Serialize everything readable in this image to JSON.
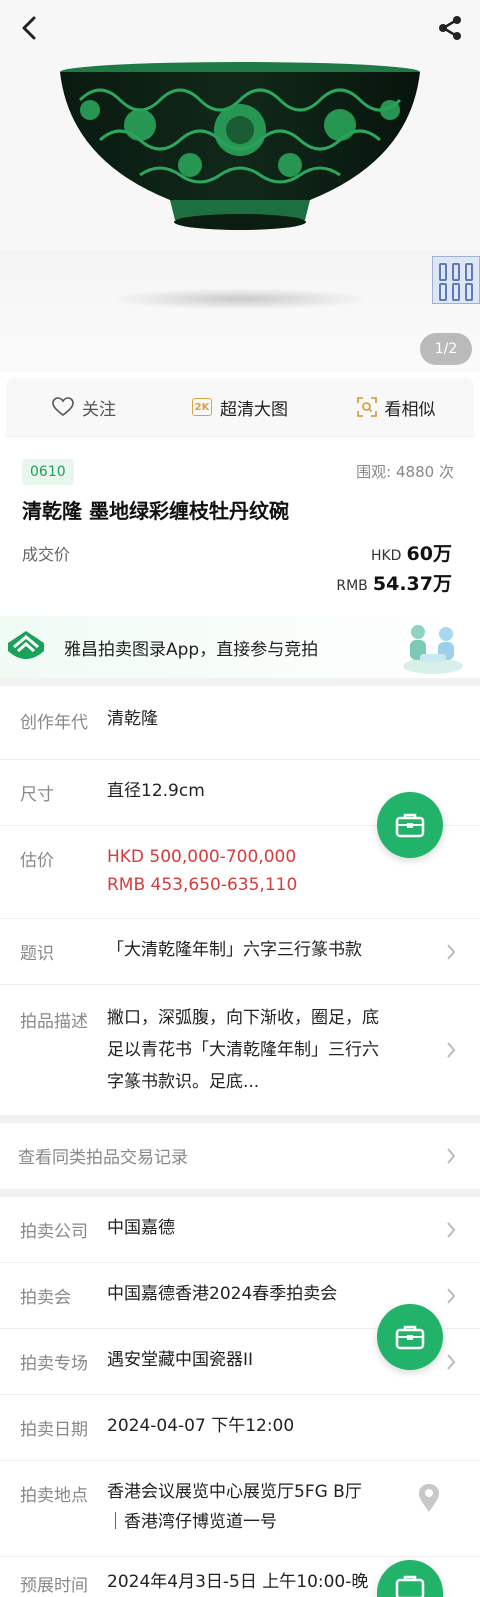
{
  "gallery": {
    "page_indicator": "1/2"
  },
  "actions": {
    "follow": "关注",
    "hd_badge": "2K",
    "hd_image": "超清大图",
    "similar": "看相似"
  },
  "lot": {
    "number": "0610",
    "views_label": "围观:",
    "views_count": "4880",
    "views_unit": "次",
    "title": "清乾隆 墨地绿彩缠枝牡丹纹碗",
    "price_label": "成交价",
    "hkd_currency": "HKD",
    "hkd_amount": "60万",
    "rmb_currency": "RMB",
    "rmb_amount": "54.37万"
  },
  "banner": {
    "text": "雅昌拍卖图录App，直接参与竞拍"
  },
  "details": {
    "era_label": "创作年代",
    "era_value": "清乾隆",
    "size_label": "尺寸",
    "size_value": "直径12.9cm",
    "estimate_label": "估价",
    "estimate_hkd": "HKD  500,000-700,000",
    "estimate_rmb": "RMB 453,650-635,110",
    "inscription_label": "题识",
    "inscription_value": "「大清乾隆年制」六字三行篆书款",
    "desc_label": "拍品描述",
    "desc_line1": "撇口，深弧腹，向下渐收，圈足，底",
    "desc_line2": "足以青花书「大清乾隆年制」三行六",
    "desc_line3": "字篆书款识。足底..."
  },
  "records_link": "查看同类拍品交易记录",
  "auction": {
    "company_label": "拍卖公司",
    "company_value": "中国嘉德",
    "session_label": "拍卖会",
    "session_value": "中国嘉德香港2024春季拍卖会",
    "special_label": "拍卖专场",
    "special_value": "遇安堂藏中国瓷器II",
    "date_label": "拍卖日期",
    "date_value": "2024-04-07 下午12:00",
    "location_label": "拍卖地点",
    "location_line1": "香港会议展览中心展览厅5FG B厅",
    "location_line2": "｜香港湾仔博览道一号",
    "preview_label": "预展时间",
    "preview_value": "2024年4月3日-5日 上午10:00-晚"
  },
  "colors": {
    "accent": "#22b36a",
    "estimate": "#d63c3c"
  }
}
